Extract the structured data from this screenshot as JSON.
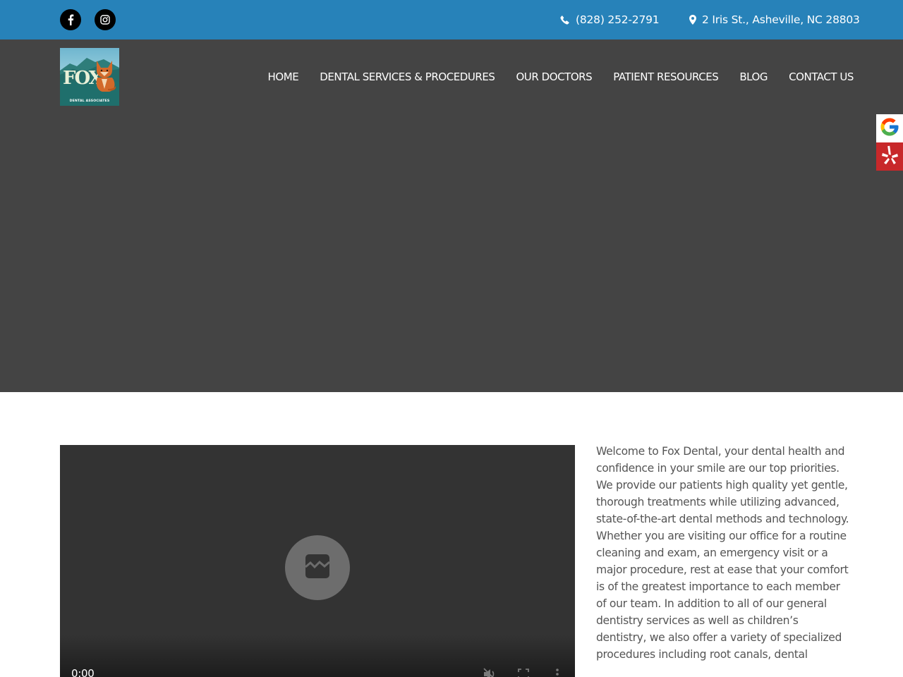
{
  "topbar": {
    "social": [
      {
        "name": "facebook",
        "icon": "facebook-icon"
      },
      {
        "name": "instagram",
        "icon": "instagram-icon"
      }
    ],
    "phone": "(828) 252-2791",
    "address": "2 Iris St., Asheville, NC 28803",
    "background_color": "#2782b9"
  },
  "header": {
    "logo": {
      "wordmark": "FOX",
      "tagline": "DENTAL ASSOCIATES"
    },
    "nav": [
      {
        "label": "HOME"
      },
      {
        "label": "DENTAL SERVICES & PROCEDURES"
      },
      {
        "label": "OUR DOCTORS"
      },
      {
        "label": "PATIENT RESOURCES"
      },
      {
        "label": "BLOG"
      },
      {
        "label": "CONTACT US"
      }
    ],
    "background_color": "#444444"
  },
  "review_badges": [
    {
      "name": "google",
      "icon": "google-icon",
      "color": "#ffffff"
    },
    {
      "name": "yelp",
      "icon": "yelp-icon",
      "color": "#c8282a"
    }
  ],
  "video": {
    "status_icon": "broken-media-icon",
    "current_time": "0:00",
    "controls": [
      "mute-icon",
      "fullscreen-icon",
      "more-options-icon"
    ]
  },
  "intro": {
    "text": "Welcome to Fox Dental, your dental health and confidence in your smile are our top priorities. We provide our patients high quality yet gentle, thorough treatments while utilizing advanced, state-of-the-art dental methods and technology. Whether you are visiting our office for a routine cleaning and exam, an emergency visit or a major procedure, rest at ease that your comfort is of the greatest importance to each member of our team. In addition to all of our general dentistry services as well as children’s dentistry, we also offer a variety of specialized procedures including root canals, dental"
  }
}
